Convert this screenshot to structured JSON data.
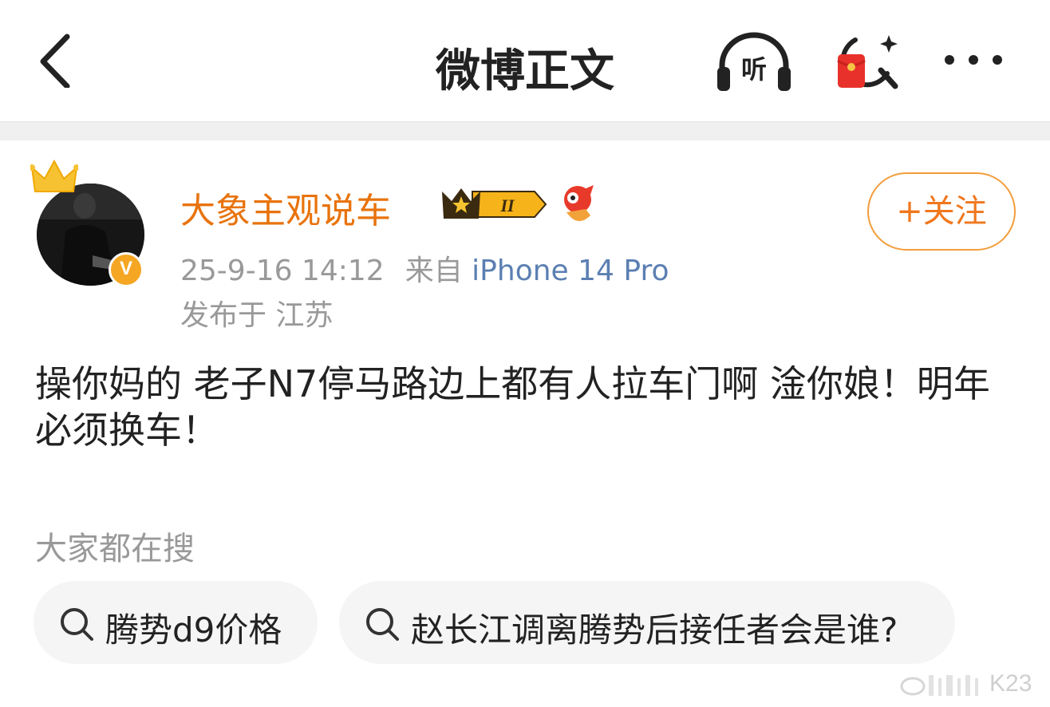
{
  "header": {
    "title": "微博正文",
    "listen_label": "听"
  },
  "post": {
    "author": "大象主观说车",
    "vip_level": "II",
    "verified_mark": "V",
    "time": "25-9-16 14:12",
    "source_prefix": "来自",
    "device": "iPhone 14 Pro",
    "location": "发布于 江苏",
    "follow_label": "+关注",
    "text": "操你妈的 老子N7停马路边上都有人拉车门啊 淦你娘！明年必须换车！"
  },
  "trending": {
    "label": "大家都在搜",
    "items": [
      {
        "label": "腾势d9价格"
      },
      {
        "label": "赵长江调离腾势后接任者会是谁?"
      }
    ]
  },
  "watermark": {
    "text": "K23"
  },
  "colors": {
    "accent_orange": "#e8730c",
    "link_blue": "#5b7fb2",
    "muted_gray": "#999999",
    "chip_bg": "#f5f5f5"
  },
  "icons": [
    "back-arrow-icon",
    "headphones-icon",
    "red-packet-icon",
    "more-icon",
    "crown-icon",
    "verified-icon",
    "vip-badge-icon",
    "mascot-icon",
    "search-icon",
    "weibo-logo-icon"
  ]
}
